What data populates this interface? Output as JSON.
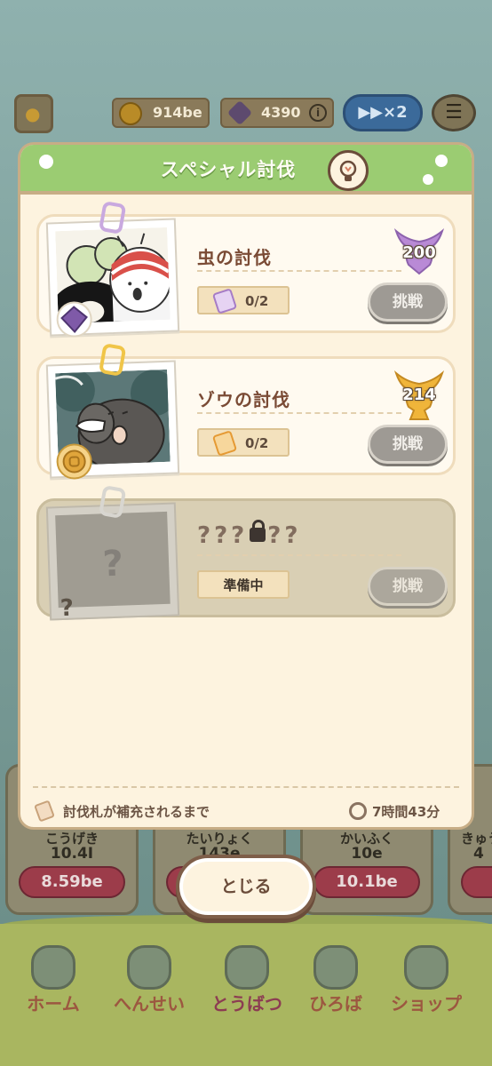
{
  "topbar": {
    "coins": "914be",
    "gems": "4390",
    "info_icon": "i",
    "speed_label": "▶▶×2",
    "menu_icon": "☰"
  },
  "bg_cards": [
    {
      "label": "こうげき",
      "value": "10.4I",
      "cost": "8.59be"
    },
    {
      "label": "たいりょく",
      "value": "143e",
      "cost": ""
    },
    {
      "label": "かいふく",
      "value": "10e",
      "cost": "10.1be"
    },
    {
      "label": "きゅう",
      "value": "4",
      "cost": ""
    }
  ],
  "nav": [
    {
      "label": "ホーム",
      "icon": "home-icon"
    },
    {
      "label": "へんせい",
      "icon": "formation-icon"
    },
    {
      "label": "とうばつ",
      "icon": "subjugation-icon"
    },
    {
      "label": "ひろば",
      "icon": "plaza-icon"
    },
    {
      "label": "ショップ",
      "icon": "shop-icon"
    }
  ],
  "modal": {
    "title": "スペシャル討伐",
    "entries": [
      {
        "title": "虫の討伐",
        "tickets": "0/2",
        "button": "挑戦",
        "reward": "200",
        "reward_color": "#b98ad6",
        "ticket_color": "#b98ad6"
      },
      {
        "title": "ゾウの討伐",
        "tickets": "0/2",
        "button": "挑戦",
        "reward": "214",
        "reward_color": "#f0b53a",
        "ticket_color": "#f0a030"
      },
      {
        "title_left": "???",
        "title_right": "??",
        "status": "準備中",
        "button": "挑戦",
        "photo_mark": "?",
        "corner_mark": "?"
      }
    ],
    "footer_left": "討伐札が補充されるまで",
    "footer_right": "7時間43分"
  },
  "close_label": "とじる"
}
